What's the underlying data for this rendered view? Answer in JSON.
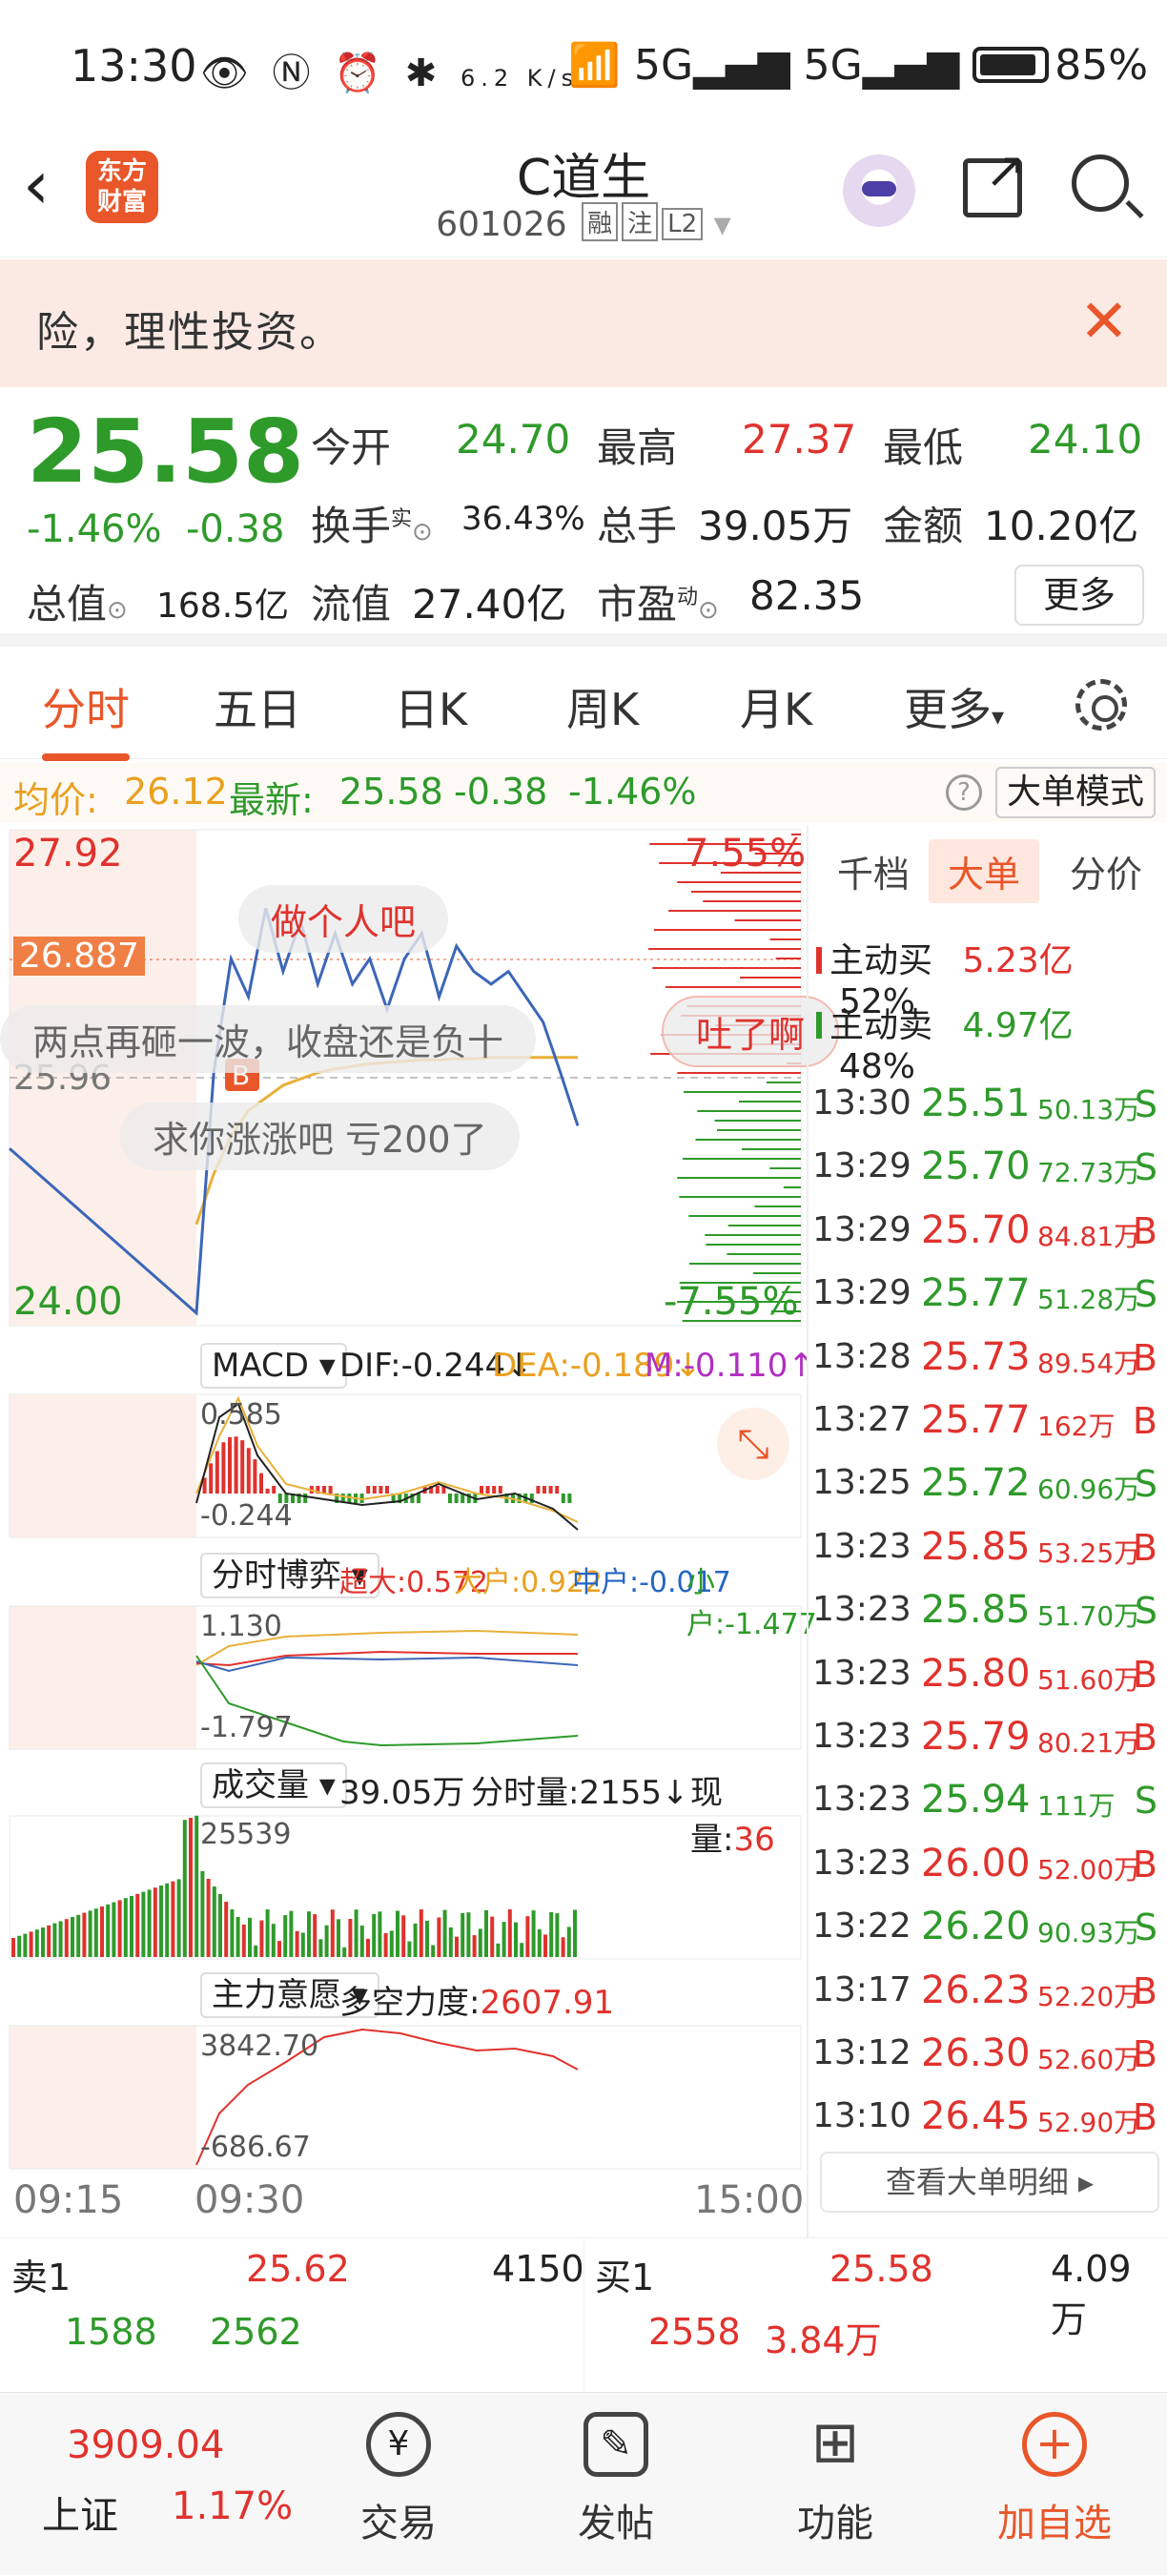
{
  "status_bar": {
    "time": "13:30",
    "net_speed": "6.2 K/s",
    "battery": "85%",
    "icons": [
      "eye-icon",
      "nfc-icon",
      "alarm-icon",
      "bluetooth-icon",
      "wifi-icon",
      "signal-5g-icon",
      "signal-5g-icon"
    ]
  },
  "header": {
    "logo": "东方财富",
    "stock_name": "C道生",
    "stock_code": "601026",
    "tags": [
      "融",
      "注",
      "L2"
    ]
  },
  "banner": {
    "text": "险，理性投资。"
  },
  "quote": {
    "price": "25.58",
    "change_pct": "-1.46%",
    "change": "-0.38",
    "open_label": "今开",
    "open": "24.70",
    "high_label": "最高",
    "high": "27.37",
    "low_label": "最低",
    "low": "24.10",
    "turnover_label": "换手",
    "turnover_sup": "实",
    "turnover": "36.43%",
    "volume_label": "总手",
    "volume": "39.05万",
    "amount_label": "金额",
    "amount": "10.20亿",
    "total_value_label": "总值",
    "total_value": "168.5亿",
    "float_value_label": "流值",
    "float_value": "27.40亿",
    "pe_label": "市盈",
    "pe_sup": "动",
    "pe": "82.35",
    "more": "更多"
  },
  "tabs": [
    "分时",
    "五日",
    "日K",
    "周K",
    "月K",
    "更多"
  ],
  "info_line": {
    "avg_label": "均价:",
    "avg": "26.12",
    "latest_label": "最新:",
    "latest": "25.58",
    "chg": "-0.38",
    "pct": "-1.46%",
    "mode": "大单模式"
  },
  "chart": {
    "y_high": "27.92",
    "y_low": "24.00",
    "pct_high": "7.55%",
    "pct_low": "-7.55%",
    "marker": "26.887",
    "mid": "25.96",
    "danmu": [
      "做个人吧",
      "两点再砸一波，收盘还是负十",
      "求你涨涨吧 亏200了",
      "吐了啊"
    ],
    "macd": {
      "label": "MACD",
      "dif": "DIF:-0.244↓",
      "dea": "DEA:-0.189↓",
      "m": "M:-0.110↑",
      "top": "0.585",
      "bottom": "-0.244"
    },
    "game": {
      "label": "分时博弈",
      "super": "超大:0.572",
      "big": "大户:0.922",
      "mid": "中户:-0.017",
      "small": "小户:-1.477",
      "top": "1.130",
      "bottom": "-1.797"
    },
    "vol": {
      "label": "成交量",
      "total": "39.05万",
      "minute": "分时量:2155↓",
      "now_label": "现量:",
      "now": "36",
      "top": "25539"
    },
    "intent": {
      "label": "主力意愿",
      "force": "多空力度:",
      "force_val": "2607.91",
      "top": "3842.70",
      "bottom": "-686.67"
    },
    "time_axis": [
      "09:15",
      "09:30",
      "15:00"
    ]
  },
  "chart_data": {
    "type": "line",
    "title": "",
    "x": [
      "09:15",
      "09:30",
      "09:35",
      "09:40",
      "09:45",
      "09:50",
      "09:55",
      "10:00",
      "10:05",
      "10:10",
      "10:15",
      "10:20",
      "10:25",
      "10:30",
      "10:40",
      "10:50",
      "11:00",
      "11:10",
      "11:20",
      "11:30",
      "13:00",
      "13:10",
      "13:20",
      "13:30"
    ],
    "series": [
      {
        "name": "",
        "values": [
          25.4,
          24.1,
          26.0,
          26.9,
          26.6,
          27.3,
          26.8,
          27.2,
          26.7,
          27.1,
          26.7,
          26.9,
          26.5,
          26.9,
          27.1,
          26.6,
          27.0,
          26.8,
          26.7,
          26.8,
          26.6,
          26.4,
          26.0,
          25.58
        ]
      },
      {
        "name": "均价",
        "values": [
          null,
          24.8,
          25.2,
          25.5,
          25.7,
          25.8,
          25.9,
          25.95,
          26.0,
          26.03,
          26.05,
          26.07,
          26.08,
          26.09,
          26.1,
          26.1,
          26.11,
          26.11,
          26.12,
          26.12,
          26.12,
          26.12,
          26.12,
          26.12
        ]
      }
    ],
    "ylim": [
      24.0,
      27.92
    ]
  },
  "right_panel": {
    "tabs": [
      "千档",
      "大单",
      "分价"
    ],
    "buy_label": "主动买",
    "buy": "5.23亿",
    "buy_pct": "52%",
    "sell_label": "主动卖",
    "sell": "4.97亿",
    "sell_pct": "48%",
    "trades": [
      {
        "t": "13:30",
        "p": "25.51",
        "v": "50.13万",
        "s": "S"
      },
      {
        "t": "13:29",
        "p": "25.70",
        "v": "72.73万",
        "s": "S"
      },
      {
        "t": "13:29",
        "p": "25.70",
        "v": "84.81万",
        "s": "B"
      },
      {
        "t": "13:29",
        "p": "25.77",
        "v": "51.28万",
        "s": "S"
      },
      {
        "t": "13:28",
        "p": "25.73",
        "v": "89.54万",
        "s": "B"
      },
      {
        "t": "13:27",
        "p": "25.77",
        "v": "162万",
        "s": "B"
      },
      {
        "t": "13:25",
        "p": "25.72",
        "v": "60.96万",
        "s": "S"
      },
      {
        "t": "13:23",
        "p": "25.85",
        "v": "53.25万",
        "s": "B"
      },
      {
        "t": "13:23",
        "p": "25.85",
        "v": "51.70万",
        "s": "S"
      },
      {
        "t": "13:23",
        "p": "25.80",
        "v": "51.60万",
        "s": "B"
      },
      {
        "t": "13:23",
        "p": "25.79",
        "v": "80.21万",
        "s": "B"
      },
      {
        "t": "13:23",
        "p": "25.94",
        "v": "111万",
        "s": "S"
      },
      {
        "t": "13:23",
        "p": "26.00",
        "v": "52.00万",
        "s": "B"
      },
      {
        "t": "13:22",
        "p": "26.20",
        "v": "90.93万",
        "s": "S"
      },
      {
        "t": "13:17",
        "p": "26.23",
        "v": "52.20万",
        "s": "B"
      },
      {
        "t": "13:12",
        "p": "26.30",
        "v": "52.60万",
        "s": "B"
      },
      {
        "t": "13:10",
        "p": "26.45",
        "v": "52.90万",
        "s": "B"
      }
    ],
    "detail": "查看大单明细 ▸"
  },
  "order_book": {
    "sell1_label": "卖1",
    "sell1_price": "25.62",
    "sell1_vol": "4150",
    "sell_a": "1588",
    "sell_b": "2562",
    "buy1_label": "买1",
    "buy1_price": "25.58",
    "buy1_vol": "4.09万",
    "buy_a": "2558",
    "buy_b": "3.84万"
  },
  "bottom_nav": {
    "index_value": "3909.04",
    "index_name": "上证",
    "index_pct": "1.17%",
    "items": [
      "交易",
      "发帖",
      "功能",
      "加自选"
    ]
  }
}
